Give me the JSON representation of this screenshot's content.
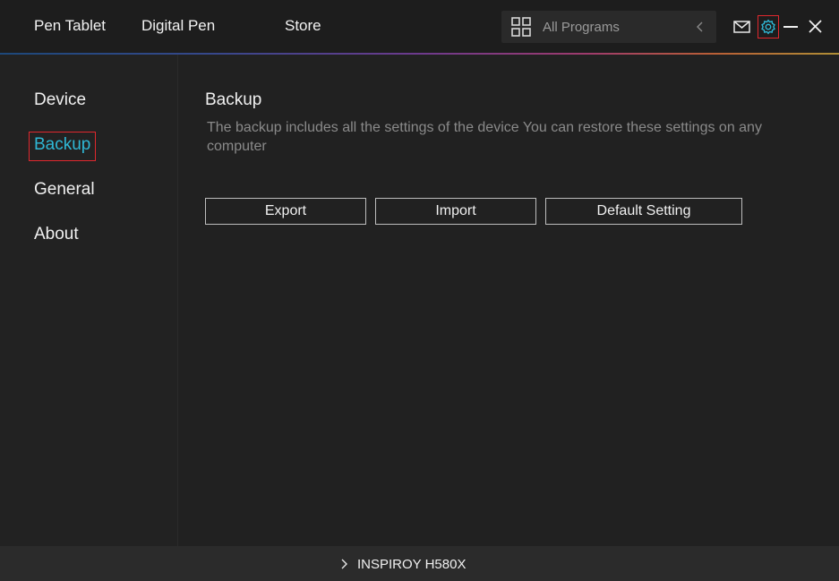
{
  "topbar": {
    "tabs": [
      "Pen Tablet",
      "Digital Pen",
      "Store"
    ],
    "program_select": {
      "value": "All Programs",
      "icon": "grid-icon"
    },
    "icons": [
      "mail-icon",
      "gear-icon",
      "minimize-icon",
      "close-icon"
    ]
  },
  "sidebar": {
    "items": [
      "Device",
      "Backup",
      "General",
      "About"
    ],
    "active": "Backup"
  },
  "main": {
    "title": "Backup",
    "description": "The backup includes all the settings of the device You can restore these settings  on any computer",
    "buttons": {
      "export": "Export",
      "import": "Import",
      "default": "Default Setting"
    }
  },
  "footer": {
    "device": "INSPIROY H580X"
  },
  "colors": {
    "accent": "#2fb8d6",
    "highlight_border": "#e0282e",
    "background": "#212121"
  }
}
